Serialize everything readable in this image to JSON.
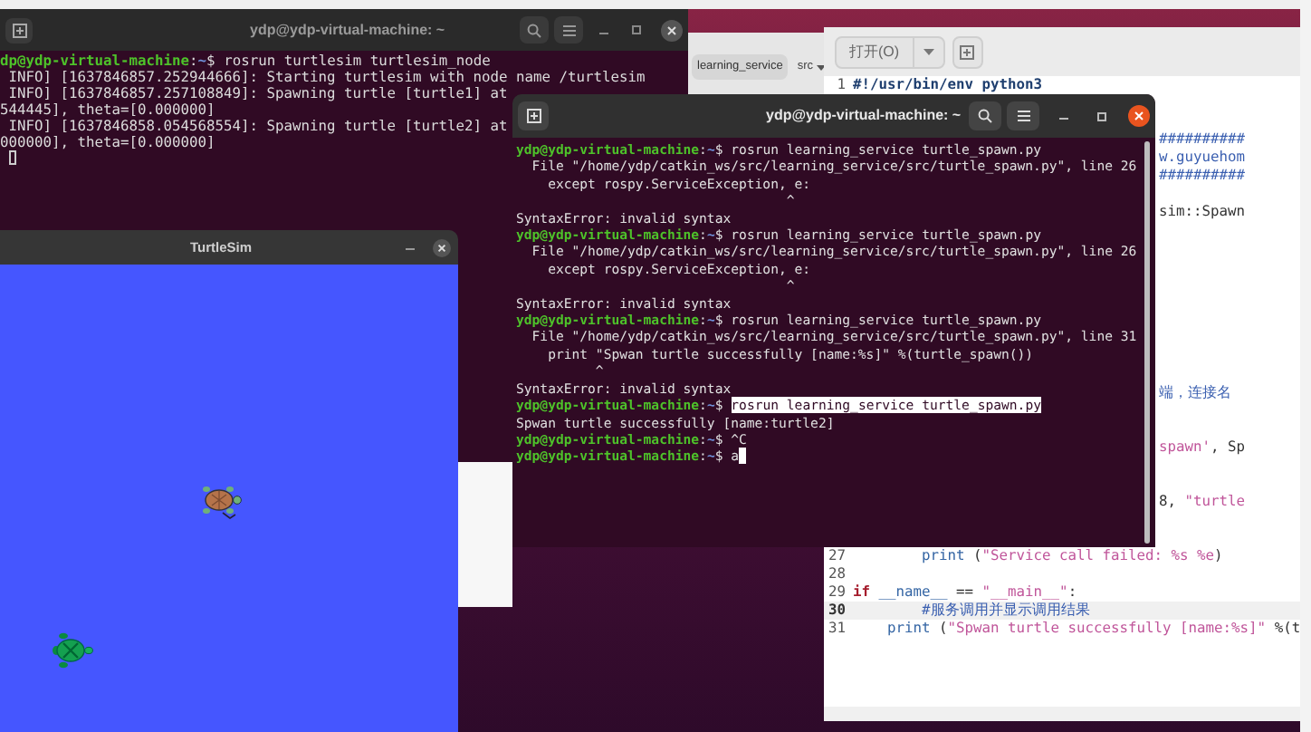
{
  "back_terminal": {
    "title": "ydp@ydp-virtual-machine: ~",
    "lines": [
      {
        "kind": "prompt",
        "user_host": "dp@ydp-virtual-machine",
        "sep": ":",
        "cwd": "~",
        "symbol": "$",
        "command": " rosrun turtlesim turtlesim_node"
      },
      {
        "kind": "output",
        "text": " INFO] [1637846857.252944666]: Starting turtlesim with node name /turtlesim"
      },
      {
        "kind": "output",
        "text": " INFO] [1637846857.257108849]: Spawning turtle [turtle1] at"
      },
      {
        "kind": "output",
        "text": "544445], theta=[0.000000]"
      },
      {
        "kind": "output",
        "text": " INFO] [1637846858.054568554]: Spawning turtle [turtle2] at"
      },
      {
        "kind": "output",
        "text": "000000], theta=[0.000000]"
      },
      {
        "kind": "blank",
        "cursor": true
      }
    ]
  },
  "file_browser": {
    "path_buttons": [
      {
        "label": "learning_service",
        "selected": true
      },
      {
        "label": "src",
        "selected": false
      }
    ]
  },
  "editor": {
    "open_button": "打开(O)",
    "lines": [
      {
        "number": "1",
        "current": false,
        "segments": [
          {
            "kind": "shebang",
            "text": "#!/usr/bin/env python3"
          }
        ]
      },
      {
        "number": "27",
        "current": false,
        "segments": [
          {
            "kind": "builtin",
            "text": "        print"
          },
          {
            "kind": "plain",
            "text": " ("
          },
          {
            "kind": "string",
            "text": "\"Service call failed: %s %e"
          },
          {
            "kind": "plain",
            "text": ")"
          }
        ]
      },
      {
        "number": "28",
        "current": false
      },
      {
        "number": "29",
        "current": false,
        "segments": [
          {
            "kind": "keyword",
            "text": "if"
          },
          {
            "kind": "name",
            "text": " __name__"
          },
          {
            "kind": "plain",
            "text": " == "
          },
          {
            "kind": "string",
            "text": "\"__main__\""
          },
          {
            "kind": "plain",
            "text": ":"
          }
        ]
      },
      {
        "number": "30",
        "current": true,
        "segments": [
          {
            "kind": "comment",
            "text": "        #服务调用并显示调用结果"
          }
        ]
      },
      {
        "number": "31",
        "current": false,
        "segments": [
          {
            "kind": "builtin",
            "text": "    print"
          },
          {
            "kind": "plain",
            "text": " ("
          },
          {
            "kind": "string",
            "text": "\"Spwan turtle successfully [name:%s]\""
          },
          {
            "kind": "plain",
            "text": " %(t"
          }
        ]
      }
    ],
    "fragments": [
      {
        "segments": [
          {
            "kind": "comment",
            "text": "##########"
          }
        ]
      },
      {
        "segments": [
          {
            "kind": "comment",
            "text": "w.guyuehom"
          }
        ]
      },
      {
        "segments": [
          {
            "kind": "comment",
            "text": "##########"
          }
        ]
      },
      {
        "segments": [
          {
            "kind": "plain",
            "text": "sim::Spawn"
          }
        ]
      },
      {
        "segments": [
          {
            "kind": "comment",
            "text": "端，连接名"
          }
        ]
      },
      {
        "segments": [
          {
            "kind": "string",
            "text": "spawn'"
          },
          {
            "kind": "plain",
            "text": ", Sp"
          }
        ]
      },
      {
        "segments": [
          {
            "kind": "plain",
            "text": "8, "
          },
          {
            "kind": "string",
            "text": "\"turtle"
          }
        ]
      }
    ]
  },
  "turtlesim": {
    "title": "TurtleSim"
  },
  "front_terminal": {
    "title": "ydp@ydp-virtual-machine: ~",
    "lines": [
      {
        "kind": "prompt",
        "user_host": "ydp@ydp-virtual-machine",
        "sep": ":",
        "cwd": "~",
        "symbol": "$",
        "command": " rosrun learning_service turtle_spawn.py",
        "selected": false
      },
      {
        "kind": "output",
        "text": "  File \"/home/ydp/catkin_ws/src/learning_service/src/turtle_spawn.py\", line 26"
      },
      {
        "kind": "output",
        "text": "    except rospy.ServiceException, e:"
      },
      {
        "kind": "output",
        "text": "                                  ^"
      },
      {
        "kind": "output",
        "text": "SyntaxError: invalid syntax"
      },
      {
        "kind": "prompt",
        "user_host": "ydp@ydp-virtual-machine",
        "sep": ":",
        "cwd": "~",
        "symbol": "$",
        "command": " rosrun learning_service turtle_spawn.py",
        "selected": false
      },
      {
        "kind": "output",
        "text": "  File \"/home/ydp/catkin_ws/src/learning_service/src/turtle_spawn.py\", line 26"
      },
      {
        "kind": "output",
        "text": "    except rospy.ServiceException, e:"
      },
      {
        "kind": "output",
        "text": "                                  ^"
      },
      {
        "kind": "output",
        "text": "SyntaxError: invalid syntax"
      },
      {
        "kind": "prompt",
        "user_host": "ydp@ydp-virtual-machine",
        "sep": ":",
        "cwd": "~",
        "symbol": "$",
        "command": " rosrun learning_service turtle_spawn.py",
        "selected": false
      },
      {
        "kind": "output",
        "text": "  File \"/home/ydp/catkin_ws/src/learning_service/src/turtle_spawn.py\", line 31"
      },
      {
        "kind": "output",
        "text": "    print \"Spwan turtle successfully [name:%s]\" %(turtle_spawn())"
      },
      {
        "kind": "output",
        "text": "          ^"
      },
      {
        "kind": "output",
        "text": "SyntaxError: invalid syntax"
      },
      {
        "kind": "prompt",
        "user_host": "ydp@ydp-virtual-machine",
        "sep": ":",
        "cwd": "~",
        "symbol": "$ ",
        "command": "rosrun learning_service turtle_spawn.py",
        "selected": true
      },
      {
        "kind": "output",
        "text": "Spwan turtle successfully [name:turtle2]"
      },
      {
        "kind": "prompt",
        "user_host": "ydp@ydp-virtual-machine",
        "sep": ":",
        "cwd": "~",
        "symbol": "$",
        "command": " ^C",
        "selected": false
      },
      {
        "kind": "prompt",
        "user_host": "ydp@ydp-virtual-machine",
        "sep": ":",
        "cwd": "~",
        "symbol": "$",
        "command": " a",
        "selected": false,
        "cursor": true
      }
    ]
  }
}
